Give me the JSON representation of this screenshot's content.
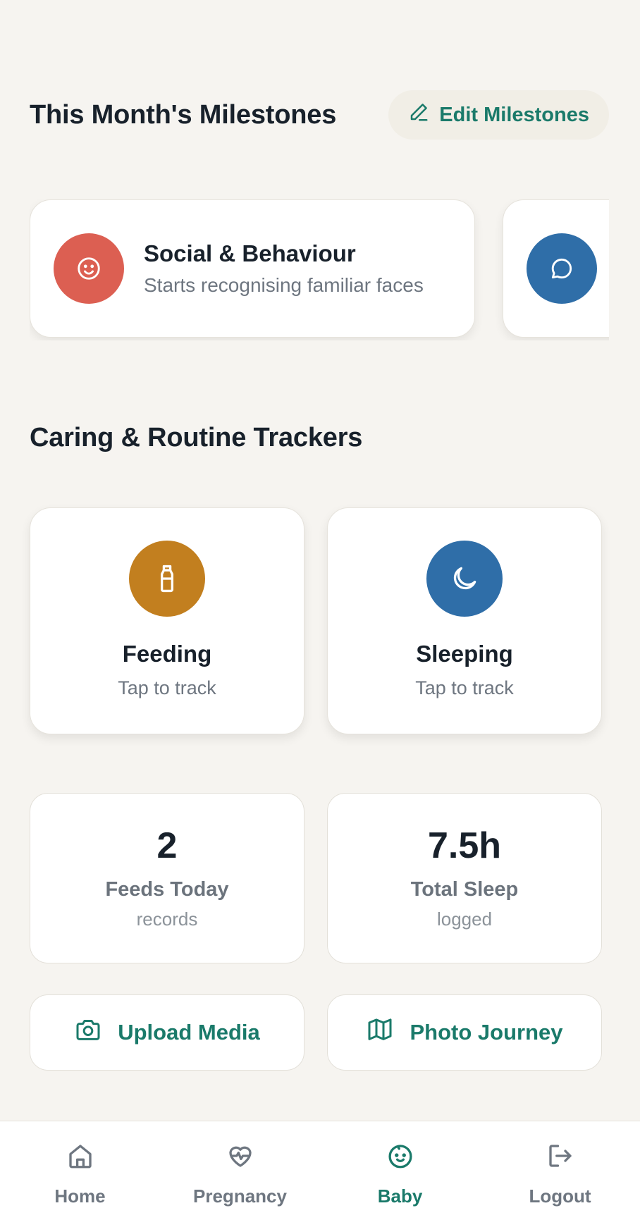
{
  "milestones": {
    "title": "This Month's Milestones",
    "edit_label": "Edit Milestones",
    "cards": [
      {
        "title": "Social & Behaviour",
        "description": "Starts recognising familiar faces",
        "icon": "smile-icon",
        "color": "#dc5f52"
      },
      {
        "title": "",
        "description": "",
        "icon": "chat-bubble-icon",
        "color": "#2f6ea8"
      }
    ]
  },
  "trackers": {
    "title": "Caring & Routine Trackers",
    "feeding": {
      "title": "Feeding",
      "subtitle": "Tap to track",
      "icon": "bottle-icon",
      "color": "#c27f1f"
    },
    "sleeping": {
      "title": "Sleeping",
      "subtitle": "Tap to track",
      "icon": "moon-icon",
      "color": "#2f6ea8"
    }
  },
  "stats": {
    "feeds": {
      "value": "2",
      "label": "Feeds Today",
      "unit": "records"
    },
    "sleep": {
      "value": "7.5h",
      "label": "Total Sleep",
      "unit": "logged"
    }
  },
  "actions": {
    "upload": {
      "label": "Upload Media",
      "icon": "camera-icon"
    },
    "journey": {
      "label": "Photo Journey",
      "icon": "map-icon"
    }
  },
  "nav": {
    "items": [
      {
        "label": "Home",
        "icon": "home-icon"
      },
      {
        "label": "Pregnancy",
        "icon": "heart-pulse-icon"
      },
      {
        "label": "Baby",
        "icon": "baby-face-icon",
        "active": true
      },
      {
        "label": "Logout",
        "icon": "logout-icon"
      }
    ]
  },
  "colors": {
    "accent": "#1a7a6a",
    "background": "#f6f4f0"
  }
}
